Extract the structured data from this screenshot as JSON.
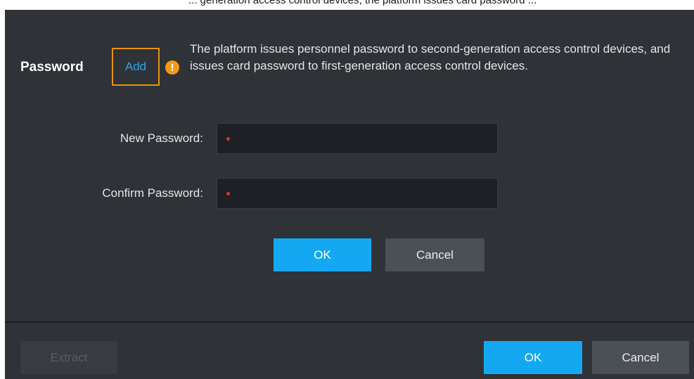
{
  "top_fragment": "... generation access control devices; the platform issues card password ...",
  "password_section": {
    "title": "Password",
    "add_link": "Add",
    "info_icon": "exclamation-icon",
    "info_text": "The platform issues personnel password to second-generation access control devices, and issues card password to first-generation access control devices."
  },
  "form": {
    "new_password_label": "New Password:",
    "confirm_password_label": "Confirm Password:",
    "ok_label": "OK",
    "cancel_label": "Cancel"
  },
  "footer": {
    "extract_label": "Extract",
    "ok_label": "OK",
    "cancel_label": "Cancel"
  },
  "colors": {
    "background": "#2f3237",
    "primary": "#14a8f2",
    "link": "#2aa4e8",
    "highlight_border": "#e8940f",
    "warning": "#f39a1d",
    "required": "#e03030"
  }
}
